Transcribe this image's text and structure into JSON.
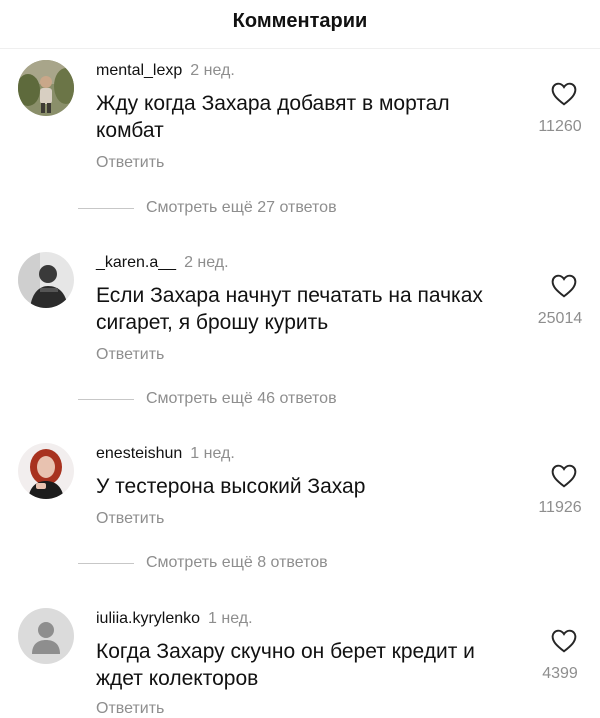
{
  "header": {
    "title": "Комментарии"
  },
  "comments": [
    {
      "username": "mental_lexp",
      "time": "2 нед.",
      "text": "Жду когда Захара добавят в мортал комбат",
      "reply_label": "Ответить",
      "likes": "11260",
      "more_replies": "Смотреть ещё 27 ответов",
      "avatar_icon": "user-photo-avatar"
    },
    {
      "username": "_karen.a__",
      "time": "2 нед.",
      "text": "Если Захара начнут печатать на пачках сигарет, я брошу курить",
      "reply_label": "Ответить",
      "likes": "25014",
      "more_replies": "Смотреть ещё 46 ответов",
      "avatar_icon": "user-photo-avatar"
    },
    {
      "username": "enesteishun",
      "time": "1 нед.",
      "text": "У тестерона высокий Захар",
      "reply_label": "Ответить",
      "likes": "11926",
      "more_replies": "Смотреть ещё 8 ответов",
      "avatar_icon": "user-photo-avatar"
    },
    {
      "username": "iuliia.kyrylenko",
      "time": "1 нед.",
      "text": "Когда Захару скучно он берет кредит и ждет колекторов",
      "reply_label": "Ответить",
      "likes": "4399",
      "avatar_icon": "default-avatar"
    }
  ],
  "colors": {
    "secondary_text": "#8e8e8e",
    "primary_text": "#111111",
    "divider": "#efefef"
  }
}
